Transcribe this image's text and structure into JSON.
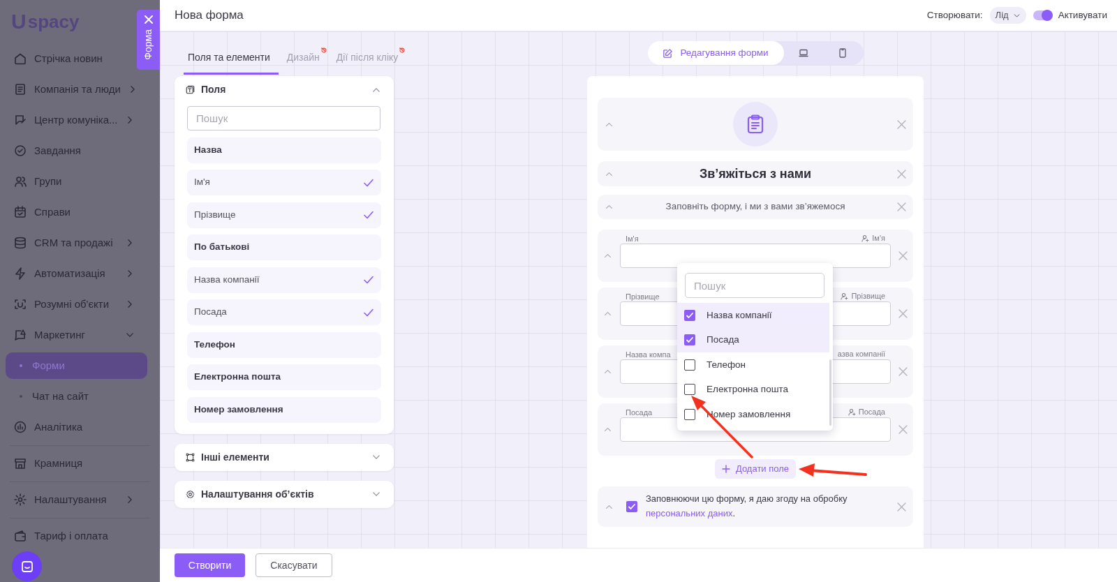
{
  "sidebar": {
    "logo": {
      "mark": "U",
      "text": "spacy"
    },
    "panel_tab": {
      "label": "Форма"
    },
    "items": [
      {
        "label": "Стрічка новин",
        "selected": false
      },
      {
        "label": "Компанія та люди",
        "selected": false,
        "expandable": true,
        "expanded": false
      },
      {
        "label": "Центр комуніка...",
        "selected": false,
        "expandable": true,
        "expanded": false
      },
      {
        "label": "Завдання",
        "selected": false
      },
      {
        "label": "Групи",
        "selected": false
      },
      {
        "label": "Справи",
        "selected": false
      },
      {
        "label": "CRM та продажі",
        "selected": false,
        "expandable": true,
        "expanded": false
      },
      {
        "label": "Автоматизація",
        "selected": false,
        "expandable": true,
        "expanded": false
      },
      {
        "label": "Розумні об'єкти",
        "selected": false,
        "expandable": true,
        "expanded": false
      },
      {
        "label": "Маркетинг",
        "selected": false,
        "expandable": true,
        "expanded": true,
        "children": [
          {
            "label": "Форми",
            "selected": true
          },
          {
            "label": "Чат на сайт",
            "selected": false
          }
        ]
      },
      {
        "label": "Аналітика",
        "selected": false
      },
      {
        "label": "Крамниця",
        "selected": false,
        "divider": true
      },
      {
        "label": "Налаштування",
        "selected": false,
        "divider": true,
        "expandable": true,
        "expanded": false
      },
      {
        "label": "Тариф і оплата",
        "selected": false,
        "divider": true
      }
    ]
  },
  "header": {
    "title": "Нова форма",
    "create_label": "Створювати:",
    "create_value": "Лід",
    "toggle": {
      "label": "Активувати",
      "on": true
    }
  },
  "builder_tabs": [
    {
      "label": "Поля та елементи",
      "selected": true,
      "alert": false
    },
    {
      "label": "Дизайн",
      "selected": false,
      "alert": true
    },
    {
      "label": "Дії після кліку",
      "selected": false,
      "alert": true
    }
  ],
  "sections": [
    {
      "title": "Поля",
      "expanded": true,
      "search": {
        "placeholder": "Пошук"
      },
      "items": [
        {
          "label": "Назва",
          "checked": false
        },
        {
          "label": "Ім'я",
          "checked": true
        },
        {
          "label": "Прізвище",
          "checked": true
        },
        {
          "label": "По батькові",
          "checked": false
        },
        {
          "label": "Назва компанії",
          "checked": true
        },
        {
          "label": "Посада",
          "checked": true
        },
        {
          "label": "Телефон",
          "checked": false
        },
        {
          "label": "Електронна пошта",
          "checked": false
        },
        {
          "label": "Номер замовлення",
          "checked": false
        }
      ]
    },
    {
      "title": "Інші елементи",
      "expanded": false
    },
    {
      "title": "Налаштування об’єктів",
      "expanded": false
    }
  ],
  "view_switch": [
    {
      "kind": "edit",
      "label": "Редагування форми",
      "selected": true
    },
    {
      "kind": "desktop",
      "selected": false
    },
    {
      "kind": "mobile",
      "selected": false
    }
  ],
  "form_blocks": [
    {
      "kind": "icon"
    },
    {
      "kind": "title",
      "text": "Зв’яжіться з нами"
    },
    {
      "kind": "subtitle",
      "text": "Заповніть форму, і ми з вами зв’яжемося"
    },
    {
      "kind": "field",
      "label": "Ім'я",
      "linked_label": "Ім'я",
      "linked_icon": true
    },
    {
      "kind": "field",
      "label": "Прізвище",
      "linked_label": "Прізвище",
      "linked_icon": true
    },
    {
      "kind": "field",
      "label": "Назва компа",
      "linked_label": "азва компанії",
      "linked_icon": false
    },
    {
      "kind": "field",
      "label": "Посада",
      "linked_label": "Посада",
      "linked_icon": true
    },
    {
      "kind": "add",
      "label": "Додати поле"
    },
    {
      "kind": "consent",
      "checked": true,
      "text": "Заповнюючи цю форму, я даю згоду на обробку ",
      "link": "персональних даних",
      "after": "."
    }
  ],
  "field_picker": {
    "search": {
      "placeholder": "Пошук"
    },
    "options": [
      {
        "label": "Назва компанії",
        "checked": true
      },
      {
        "label": "Посада",
        "checked": true
      },
      {
        "label": "Телефон",
        "checked": false
      },
      {
        "label": "Електронна пошта",
        "checked": false
      },
      {
        "label": "Номер замовлення",
        "checked": false
      }
    ]
  },
  "annotations": [
    {
      "kind": "arrow"
    },
    {
      "kind": "arrow"
    }
  ],
  "footer_buttons": [
    {
      "label": "Створити",
      "kind": "primary"
    },
    {
      "label": "Скасувати",
      "kind": "secondary"
    }
  ]
}
